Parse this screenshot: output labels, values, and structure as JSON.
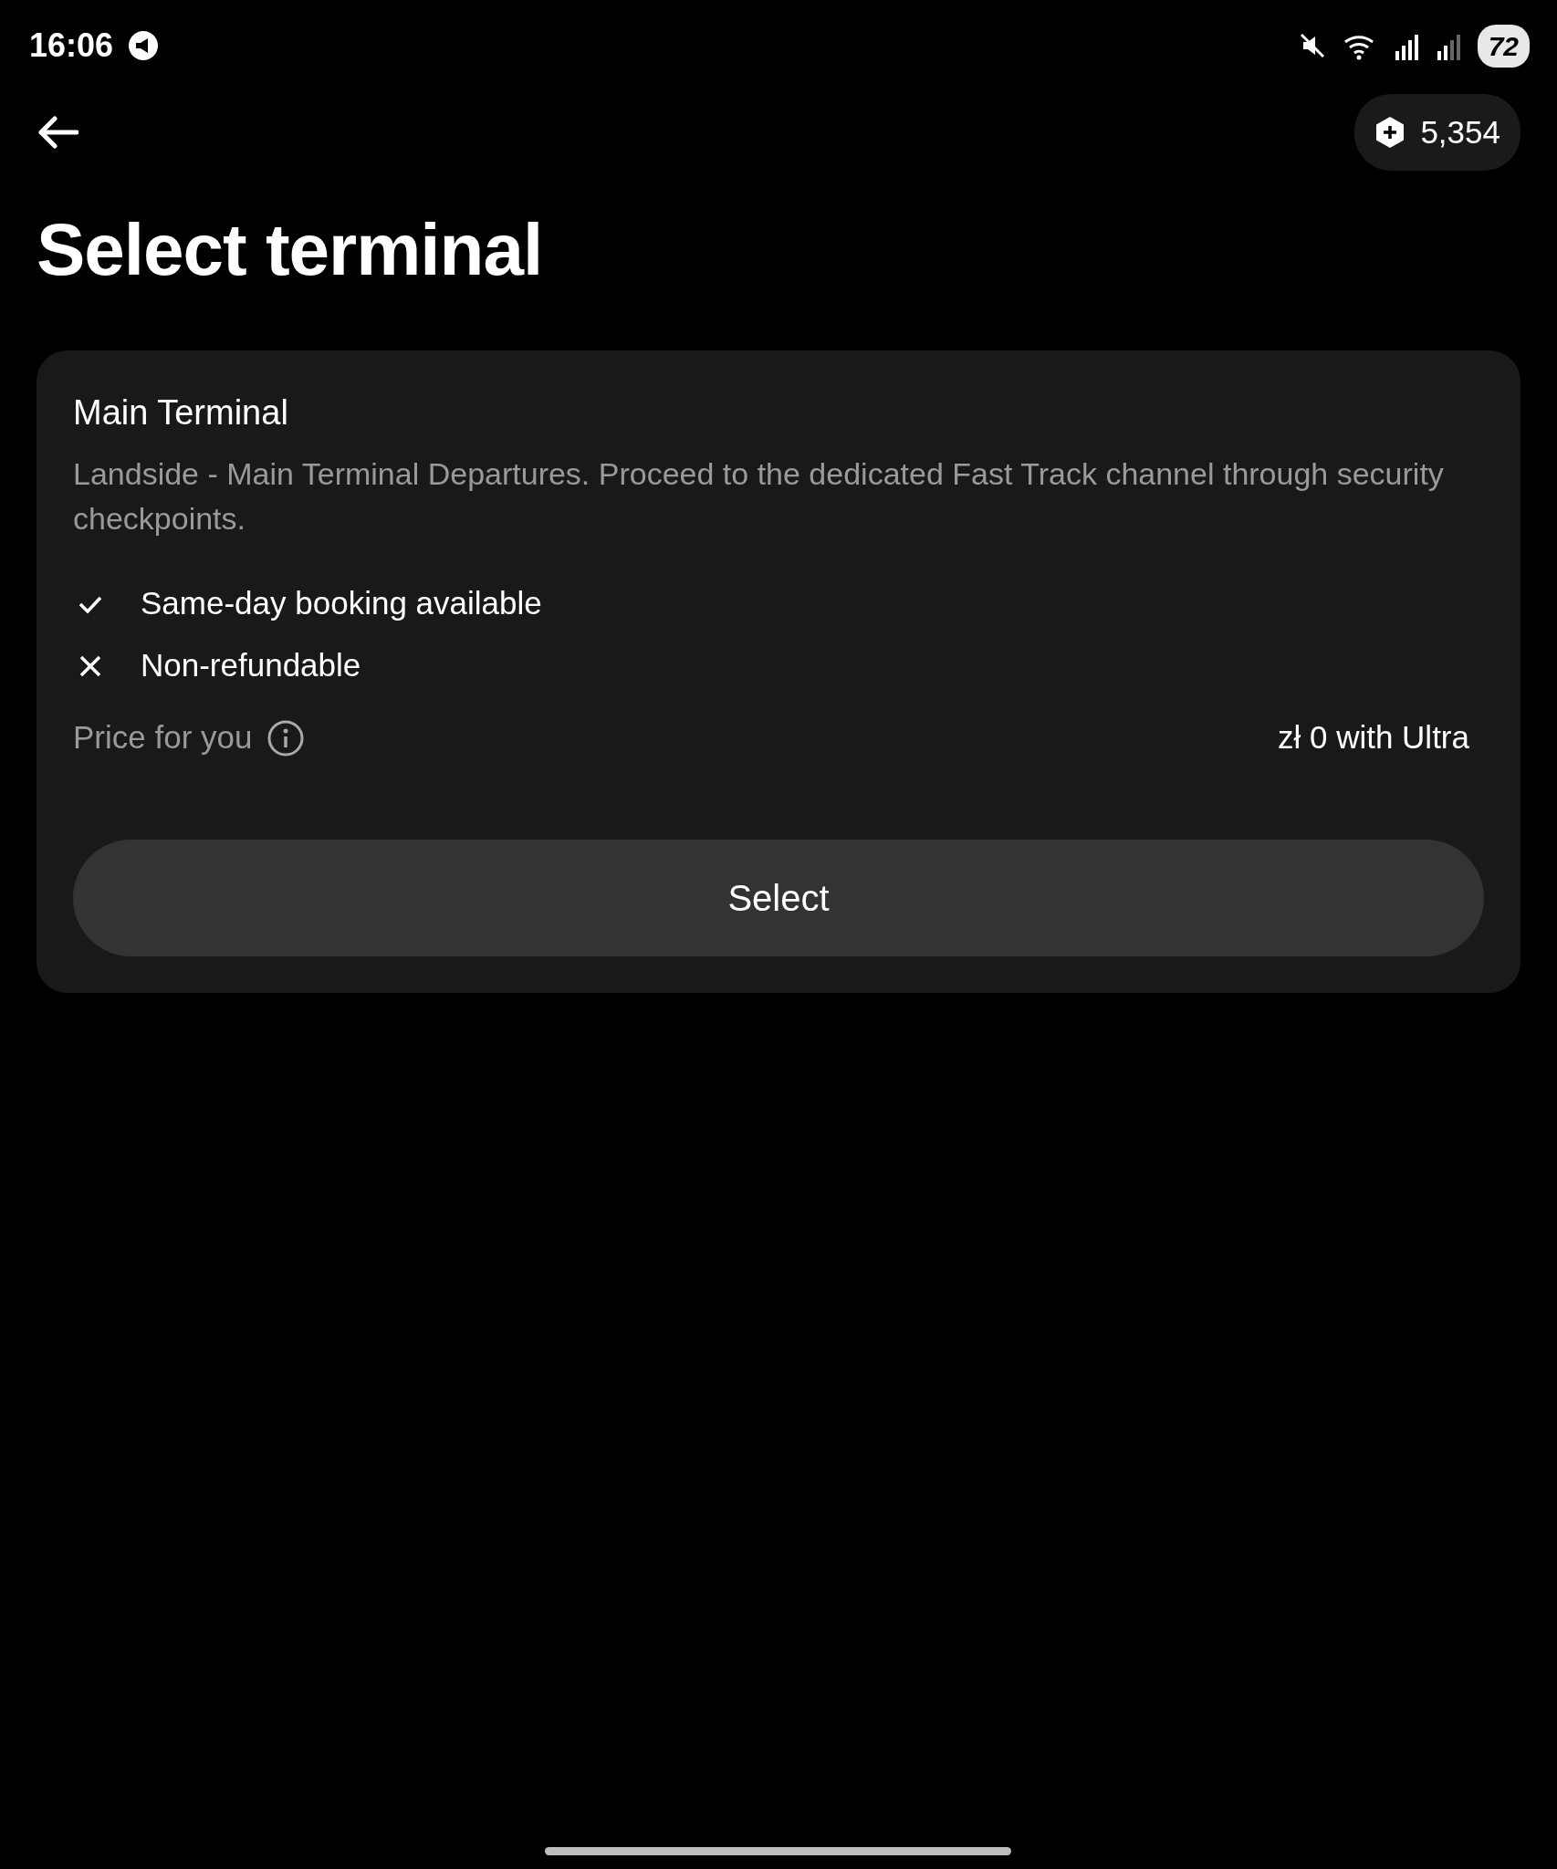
{
  "status_bar": {
    "time": "16:06",
    "battery": "72"
  },
  "header": {
    "points": "5,354"
  },
  "title": "Select terminal",
  "terminals": [
    {
      "name": "Main Terminal",
      "description": "Landside - Main Terminal Departures. Proceed to the dedicated Fast Track channel through security checkpoints.",
      "features": [
        {
          "kind": "included",
          "label": "Same-day booking available"
        },
        {
          "kind": "excluded",
          "label": "Non-refundable"
        }
      ],
      "price_label": "Price for you",
      "price": "zł 0 with Ultra",
      "button": "Select"
    }
  ]
}
